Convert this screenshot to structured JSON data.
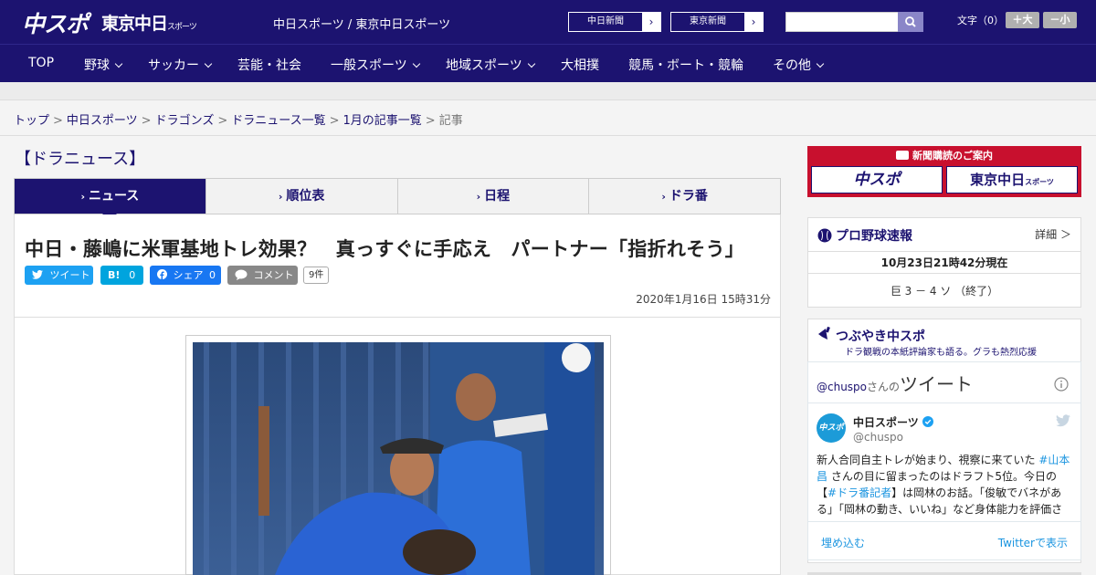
{
  "header": {
    "logo_primary": "中スポ",
    "logo_secondary": "東京中日",
    "logo_secondary_small": "スポーツ",
    "tagline": "中日スポーツ / 東京中日スポーツ",
    "paper_buttons": [
      "中日新聞",
      "東京新聞"
    ],
    "font_size_label": "文字（0）",
    "font_larger": "＋大",
    "font_smaller": "－小"
  },
  "nav": {
    "items": [
      {
        "label": "TOP",
        "dropdown": false
      },
      {
        "label": "野球",
        "dropdown": true
      },
      {
        "label": "サッカー",
        "dropdown": true
      },
      {
        "label": "芸能・社会",
        "dropdown": false
      },
      {
        "label": "一般スポーツ",
        "dropdown": true
      },
      {
        "label": "地域スポーツ",
        "dropdown": true
      },
      {
        "label": "大相撲",
        "dropdown": false
      },
      {
        "label": "競馬・ボート・競輪",
        "dropdown": false
      },
      {
        "label": "その他",
        "dropdown": true
      }
    ]
  },
  "breadcrumb": {
    "items": [
      "トップ",
      "中日スポーツ",
      "ドラゴンズ",
      "ドラニュース一覧",
      "1月の記事一覧"
    ],
    "current": "記事",
    "separator": ">"
  },
  "section": {
    "heading": "【ドラニュース】",
    "tabs": [
      "ニュース",
      "順位表",
      "日程",
      "ドラ番"
    ],
    "active_tab": 0
  },
  "article": {
    "headline": "中日・藤嶋に米軍基地トレ効果？　真っすぐに手応え　パートナー「指折れそう」",
    "share": {
      "tweet": "ツイート",
      "hatena": "B!",
      "hatena_count": "0",
      "facebook": "シェア",
      "facebook_count": "0",
      "comment": "コメント",
      "comment_count": "9件"
    },
    "date": "2020年1月16日 15時31分"
  },
  "sidebar": {
    "ad": {
      "title": "新聞購読のご案内",
      "left": "中スポ",
      "right": "東京中日",
      "right_small": "スポーツ"
    },
    "baseball": {
      "title": "プロ野球速報",
      "more": "詳細 ＞",
      "timestamp": "10月23日21時42分現在",
      "score": "巨 3 － 4 ソ （終了）"
    },
    "tsubuyaki": {
      "title": "つぶやき中スポ",
      "subtitle": "ドラ観戦の本紙評論家も語る。グラも熱烈応援"
    },
    "twitter": {
      "header_handle": "@chuspo",
      "header_suffix": "さんの",
      "header_title": "ツイート",
      "account_name": "中日スポーツ",
      "account_handle": "@chuspo",
      "avatar_text": "中スポ",
      "tweet_pre": "新人合同自主トレが始まり、視察に来ていた ",
      "tweet_tag1": "#山本昌",
      "tweet_mid1": " さんの目に留まったのはドラフト5位。今日の【",
      "tweet_tag2": "#ドラ番記者",
      "tweet_mid2": "】は岡林のお話。「俊敏でバネがある」「岡林の動き、いいね」など身体能力を評価さ",
      "embed": "埋め込む",
      "view_on": "Twitterで表示"
    }
  },
  "colors": {
    "brand": "#1c1370",
    "ad_red": "#c8102e",
    "twitter": "#1da1f2",
    "facebook": "#1877f2",
    "hatena": "#00a4de"
  }
}
